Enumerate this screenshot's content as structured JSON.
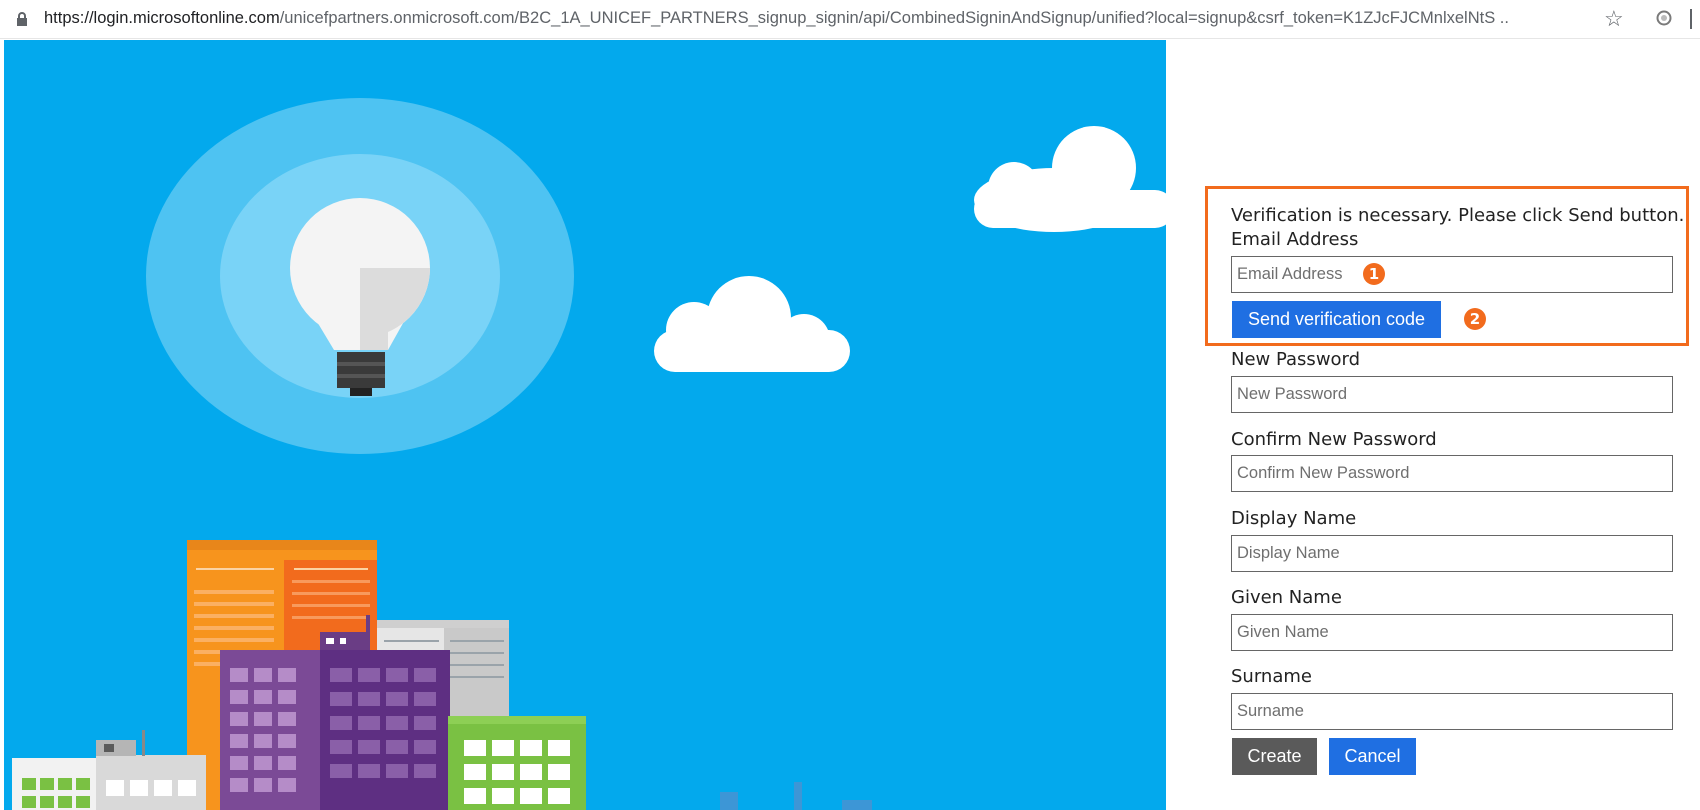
{
  "browser": {
    "url_host": "https://login.microsoftonline.com",
    "url_path": "/unicefpartners.onmicrosoft.com/B2C_1A_UNICEF_PARTNERS_signup_signin/api/CombinedSigninAndSignup/unified?local=signup&csrf_token=K1ZJcFJCMnlxelNtS ..",
    "icons": [
      "lock-icon",
      "star-icon",
      "extension-icon"
    ]
  },
  "verification": {
    "message": "Verification is necessary. Please click Send button.",
    "email_label": "Email Address",
    "email_placeholder": "Email Address",
    "send_button": "Send verification code",
    "badge_1": "1",
    "badge_2": "2",
    "highlight_color": "#f26b1d"
  },
  "fields": {
    "new_password_label": "New Password",
    "new_password_placeholder": "New Password",
    "confirm_password_label": "Confirm New Password",
    "confirm_password_placeholder": "Confirm New Password",
    "display_name_label": "Display Name",
    "display_name_placeholder": "Display Name",
    "given_name_label": "Given Name",
    "given_name_placeholder": "Given Name",
    "surname_label": "Surname",
    "surname_placeholder": "Surname"
  },
  "actions": {
    "create": "Create",
    "cancel": "Cancel"
  },
  "colors": {
    "hero_background": "#03a9ed",
    "primary_button": "#1f6fe2",
    "create_button": "#5a5a5a"
  }
}
